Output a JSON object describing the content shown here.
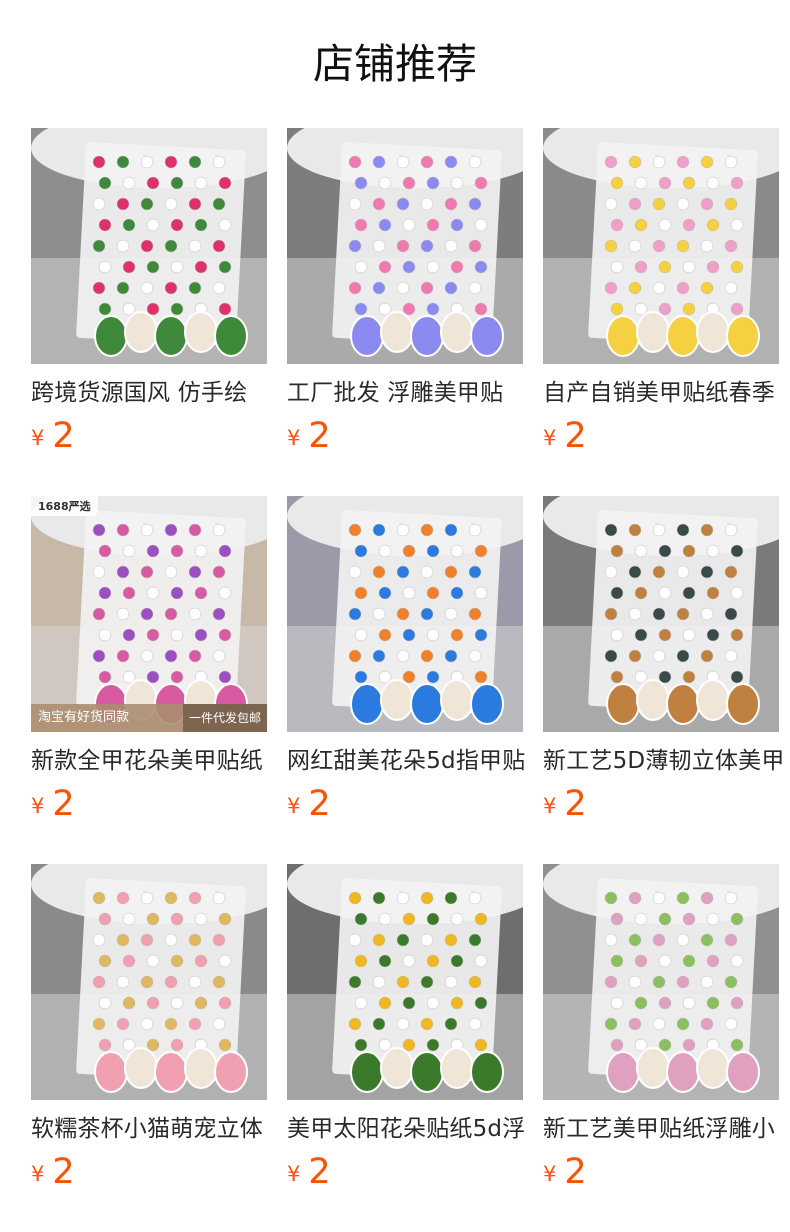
{
  "header": {
    "title": "店铺推荐"
  },
  "colors": {
    "price": "#ff5000",
    "badge_bg": "#a88c6e"
  },
  "products": [
    {
      "name": "跨境货源国风 仿手绘",
      "currency": "¥",
      "price": "2",
      "motif": "bird-sticker-sheet",
      "accent": "#e0306a",
      "accent2": "#3f8a3a"
    },
    {
      "name": "工厂批发 浮雕美甲贴",
      "currency": "¥",
      "price": "2",
      "motif": "lace-border-sticker-sheet",
      "accent": "#f07ab0",
      "accent2": "#8a8af0"
    },
    {
      "name": "自产自销美甲贴纸春季",
      "currency": "¥",
      "price": "2",
      "motif": "cute-flower-sticker-sheet",
      "accent": "#f0a0c8",
      "accent2": "#f5d040"
    },
    {
      "name": "新款全甲花朵美甲贴纸",
      "currency": "¥",
      "price": "2",
      "motif": "purple-flower-sticker-sheet",
      "accent": "#9c4fc0",
      "accent2": "#d85aa0",
      "badge_top": "1688严选",
      "badge_left": "淘宝有好货同款",
      "badge_right": "一件代发包邮"
    },
    {
      "name": "网红甜美花朵5d指甲贴",
      "currency": "¥",
      "price": "2",
      "motif": "colorful-flower-sticker-sheet",
      "accent": "#f0802a",
      "accent2": "#2a7ae0"
    },
    {
      "name": "新工艺5D薄韧立体美甲",
      "currency": "¥",
      "price": "2",
      "motif": "butterfly-sticker-sheet",
      "accent": "#3a4a4a",
      "accent2": "#c08040"
    },
    {
      "name": "软糯茶杯小猫萌宠立体",
      "currency": "¥",
      "price": "2",
      "motif": "kitten-sticker-sheet",
      "accent": "#e0b860",
      "accent2": "#f0a0b0"
    },
    {
      "name": "美甲太阳花朵贴纸5d浮",
      "currency": "¥",
      "price": "2",
      "motif": "sunflower-sticker-sheet",
      "accent": "#f0b820",
      "accent2": "#3a7a2a"
    },
    {
      "name": "新工艺美甲贴纸浮雕小",
      "currency": "¥",
      "price": "2",
      "motif": "bunny-sticker-sheet",
      "accent": "#8ac060",
      "accent2": "#e0a0c0"
    }
  ]
}
